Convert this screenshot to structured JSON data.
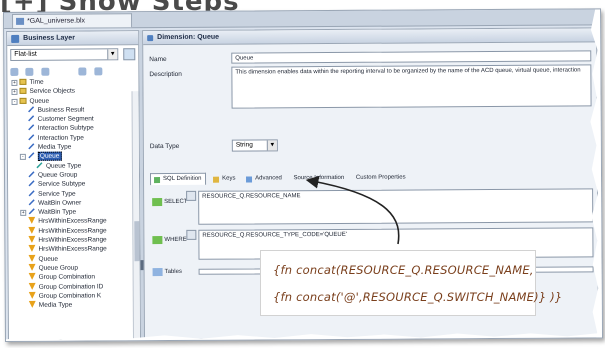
{
  "heading": "[+] Show Steps",
  "window": {
    "tab_label": "*GAL_universe.blx"
  },
  "left_panel": {
    "title": "Business Layer",
    "combo_value": "Flat-list",
    "tree": [
      {
        "label": "Time",
        "indent": 1,
        "type": "folder",
        "exp": "+"
      },
      {
        "label": "Service Objects",
        "indent": 1,
        "type": "folder",
        "exp": "+"
      },
      {
        "label": "Queue",
        "indent": 1,
        "type": "folder",
        "exp": "-"
      },
      {
        "label": "Business Result",
        "indent": 2,
        "type": "dim"
      },
      {
        "label": "Customer Segment",
        "indent": 2,
        "type": "dim"
      },
      {
        "label": "Interaction Subtype",
        "indent": 2,
        "type": "dim"
      },
      {
        "label": "Interaction Type",
        "indent": 2,
        "type": "dim"
      },
      {
        "label": "Media Type",
        "indent": 2,
        "type": "dim"
      },
      {
        "label": "Queue",
        "indent": 2,
        "type": "dim",
        "exp": "-",
        "selected": true
      },
      {
        "label": "Queue Type",
        "indent": 3,
        "type": "detail"
      },
      {
        "label": "Queue Group",
        "indent": 2,
        "type": "dim"
      },
      {
        "label": "Service Subtype",
        "indent": 2,
        "type": "dim"
      },
      {
        "label": "Service Type",
        "indent": 2,
        "type": "dim"
      },
      {
        "label": "WaitBin Owner",
        "indent": 2,
        "type": "dim"
      },
      {
        "label": "WaitBin Type",
        "indent": 2,
        "type": "dim",
        "exp": "+"
      },
      {
        "label": "HrsWithinExcessRange",
        "indent": 2,
        "type": "meas"
      },
      {
        "label": "HrsWithinExcessRange",
        "indent": 2,
        "type": "meas"
      },
      {
        "label": "HrsWithinExcessRange",
        "indent": 2,
        "type": "meas"
      },
      {
        "label": "HrsWithinExcessRange",
        "indent": 2,
        "type": "meas"
      },
      {
        "label": "Queue",
        "indent": 2,
        "type": "meas"
      },
      {
        "label": "Queue Group",
        "indent": 2,
        "type": "meas"
      },
      {
        "label": "Group Combination",
        "indent": 2,
        "type": "meas"
      },
      {
        "label": "Group Combination ID",
        "indent": 2,
        "type": "meas"
      },
      {
        "label": "Group Combination K",
        "indent": 2,
        "type": "meas"
      },
      {
        "label": "Media Type",
        "indent": 2,
        "type": "meas"
      }
    ]
  },
  "right_panel": {
    "title": "Dimension: Queue",
    "name_label": "Name",
    "name_value": "Queue",
    "description_label": "Description",
    "description_value": "This dimension enables data within the reporting interval to be organized by the name of the ACD queue, virtual queue, interaction",
    "datatype_label": "Data Type",
    "datatype_value": "String",
    "subtabs": [
      "SQL Definition",
      "Keys",
      "Advanced",
      "Source Information",
      "Custom Properties"
    ],
    "select_label": "SELECT",
    "select_value": "RESOURCE_Q.RESOURCE_NAME",
    "where_label": "WHERE",
    "where_value": "RESOURCE_Q.RESOURCE_TYPE_CODE='QUEUE'",
    "tables_label": "Tables"
  },
  "callout": {
    "line1": "{fn concat(RESOURCE_Q.RESOURCE_NAME,",
    "line2": "{fn concat('@',RESOURCE_Q.SWITCH_NAME)} )}"
  },
  "colors": {
    "callout_text": "#7a3f1c",
    "selection": "#2f5fb3",
    "panel_bg": "#eef2f7"
  }
}
